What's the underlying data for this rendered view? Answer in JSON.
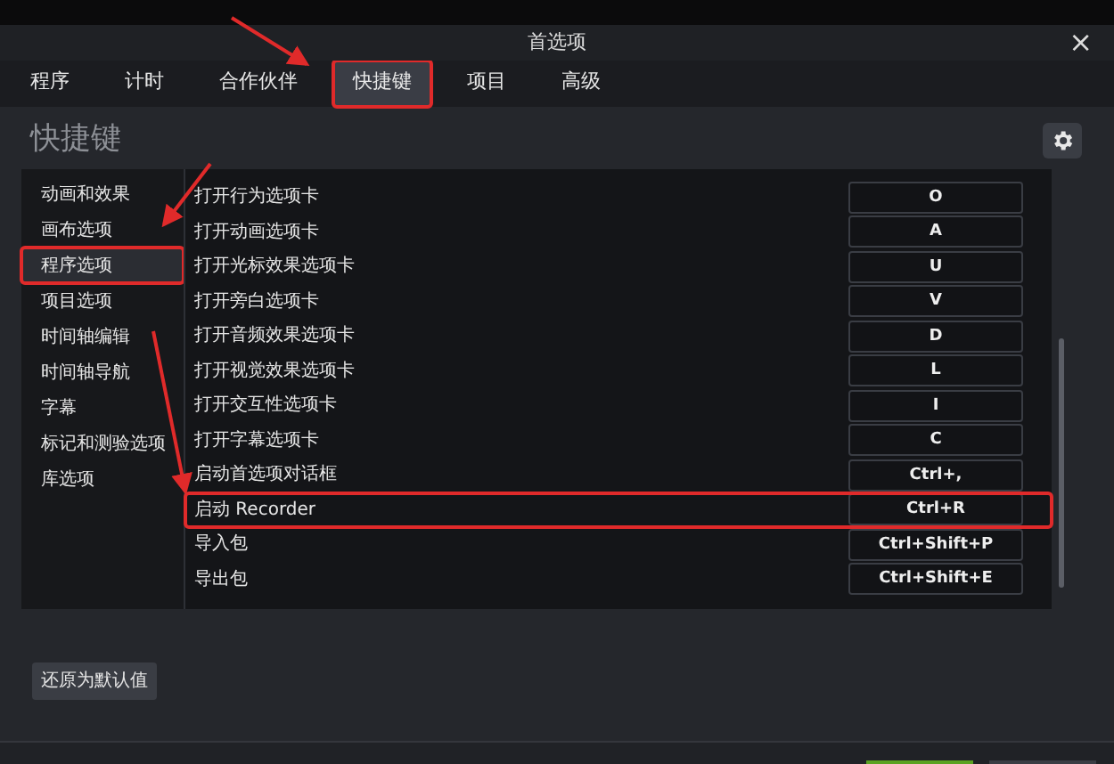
{
  "window": {
    "title": "首选项",
    "close": "×"
  },
  "tabs": [
    {
      "label": "程序",
      "selected": false,
      "highlighted": false
    },
    {
      "label": "计时",
      "selected": false,
      "highlighted": false
    },
    {
      "label": "合作伙伴",
      "selected": false,
      "highlighted": false
    },
    {
      "label": "快捷键",
      "selected": true,
      "highlighted": true
    },
    {
      "label": "项目",
      "selected": false,
      "highlighted": false
    },
    {
      "label": "高级",
      "selected": false,
      "highlighted": false
    }
  ],
  "heading": "快捷键",
  "sidebar": {
    "items": [
      {
        "label": "动画和效果",
        "selected": false,
        "highlighted": false
      },
      {
        "label": "画布选项",
        "selected": false,
        "highlighted": false
      },
      {
        "label": "程序选项",
        "selected": true,
        "highlighted": true
      },
      {
        "label": "项目选项",
        "selected": false,
        "highlighted": false
      },
      {
        "label": "时间轴编辑",
        "selected": false,
        "highlighted": false
      },
      {
        "label": "时间轴导航",
        "selected": false,
        "highlighted": false
      },
      {
        "label": "字幕",
        "selected": false,
        "highlighted": false
      },
      {
        "label": "标记和测验选项",
        "selected": false,
        "highlighted": false
      },
      {
        "label": "库选项",
        "selected": false,
        "highlighted": false
      }
    ]
  },
  "shortcuts": [
    {
      "action": "打开行为选项卡",
      "key": "O",
      "highlighted": false
    },
    {
      "action": "打开动画选项卡",
      "key": "A",
      "highlighted": false
    },
    {
      "action": "打开光标效果选项卡",
      "key": "U",
      "highlighted": false
    },
    {
      "action": "打开旁白选项卡",
      "key": "V",
      "highlighted": false
    },
    {
      "action": "打开音频效果选项卡",
      "key": "D",
      "highlighted": false
    },
    {
      "action": "打开视觉效果选项卡",
      "key": "L",
      "highlighted": false
    },
    {
      "action": "打开交互性选项卡",
      "key": "I",
      "highlighted": false
    },
    {
      "action": "打开字幕选项卡",
      "key": "C",
      "highlighted": false
    },
    {
      "action": "启动首选项对话框",
      "key": "Ctrl+,",
      "highlighted": false
    },
    {
      "action": "启动 Recorder",
      "key": "Ctrl+R",
      "highlighted": true
    },
    {
      "action": "导入包",
      "key": "Ctrl+Shift+P",
      "highlighted": false
    },
    {
      "action": "导出包",
      "key": "Ctrl+Shift+E",
      "highlighted": false
    }
  ],
  "reset_button": "还原为默认值"
}
